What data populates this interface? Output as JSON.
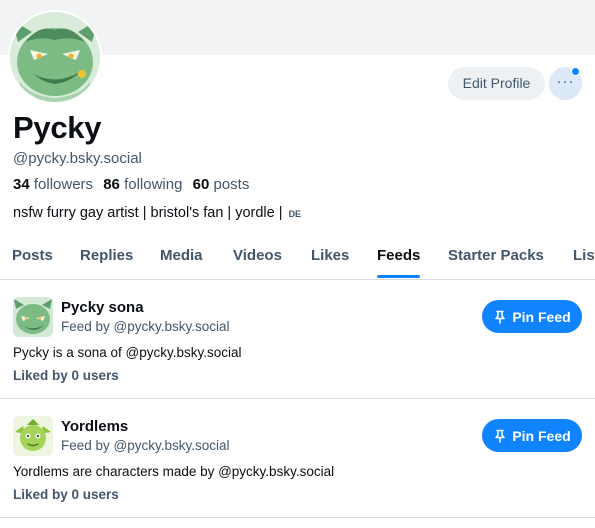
{
  "profile": {
    "display_name": "Pycky",
    "handle": "@pycky.bsky.social",
    "followers_count": "34",
    "followers_label": "followers",
    "following_count": "86",
    "following_label": "following",
    "posts_count": "60",
    "posts_label": "posts",
    "bio": "nsfw furry gay artist | bristol's fan | yordle |",
    "bio_language": "DE",
    "edit_profile_label": "Edit Profile",
    "more_label": "···"
  },
  "tabs": [
    {
      "label": "Posts"
    },
    {
      "label": "Replies"
    },
    {
      "label": "Media"
    },
    {
      "label": "Videos"
    },
    {
      "label": "Likes"
    },
    {
      "label": "Feeds"
    },
    {
      "label": "Starter Packs"
    },
    {
      "label": "Lists"
    }
  ],
  "active_tab": "Feeds",
  "feeds": [
    {
      "title": "Pycky sona",
      "byline": "Feed by @pycky.bsky.social",
      "description": "Pycky is a sona of @pycky.bsky.social",
      "likes": "Liked by 0 users",
      "pin_label": "Pin Feed"
    },
    {
      "title": "Yordlems",
      "byline": "Feed by @pycky.bsky.social",
      "description": "Yordlems are characters made by @pycky.bsky.social",
      "likes": "Liked by 0 users",
      "pin_label": "Pin Feed"
    }
  ],
  "colors": {
    "accent": "#1083fe",
    "text_primary": "#0b0f14",
    "text_secondary": "#42576c",
    "divider": "#d4dbe2",
    "banner": "#f1f3f5"
  },
  "icons": {
    "avatar": "green-creature-avatar",
    "more": "more-dots-icon",
    "pin": "pin-icon"
  }
}
